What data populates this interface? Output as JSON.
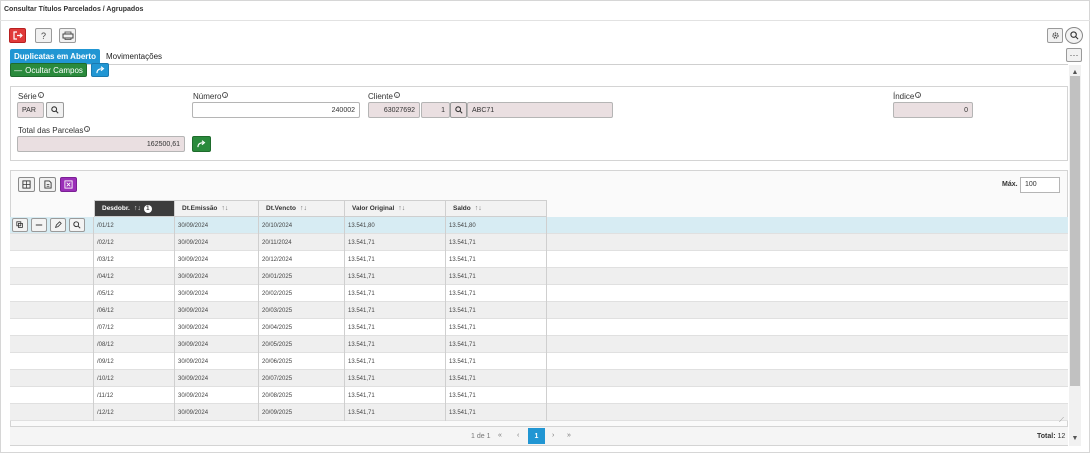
{
  "window": {
    "title": "Consultar Títulos Parcelados / Agrupados"
  },
  "toolbar": {
    "exit_icon": "exit-icon",
    "help_label": "?",
    "help_icon": "question-icon",
    "print_icon": "printer-icon",
    "settings_icon": "gear-icon",
    "search_icon": "search-icon",
    "more_label": "···"
  },
  "tabs": [
    {
      "label": "Duplicatas em Aberto",
      "active": true
    },
    {
      "label": "Movimentações",
      "active": false
    }
  ],
  "actions": {
    "hide_fields_label": "Ocultar Campos",
    "share_icon": "share-icon"
  },
  "form": {
    "serie": {
      "label": "Série",
      "value": "PAR"
    },
    "numero": {
      "label": "Número",
      "value": "240002"
    },
    "cliente": {
      "label": "Cliente",
      "code": "63027692",
      "seq": "1",
      "name": "ABC71"
    },
    "indice": {
      "label": "Índice",
      "value": "0"
    },
    "total_parcelas": {
      "label": "Total das Parcelas",
      "value": "162500,61"
    }
  },
  "grid": {
    "max_label": "Máx.",
    "max_value": "100",
    "columns": [
      {
        "label": "Desdobr.",
        "sort_icon": "sort-asc-icon",
        "badge": "1"
      },
      {
        "label": "Dt.Emissão",
        "sort_icon": "sort-icon"
      },
      {
        "label": "Dt.Vencto",
        "sort_icon": "sort-icon"
      },
      {
        "label": "Valor Original",
        "sort_icon": "sort-icon"
      },
      {
        "label": "Saldo",
        "sort_icon": "sort-icon"
      }
    ],
    "rows": [
      [
        "/01/12",
        "30/09/2024",
        "20/10/2024",
        "13.541,80",
        "13.541,80"
      ],
      [
        "/02/12",
        "30/09/2024",
        "20/11/2024",
        "13.541,71",
        "13.541,71"
      ],
      [
        "/03/12",
        "30/09/2024",
        "20/12/2024",
        "13.541,71",
        "13.541,71"
      ],
      [
        "/04/12",
        "30/09/2024",
        "20/01/2025",
        "13.541,71",
        "13.541,71"
      ],
      [
        "/05/12",
        "30/09/2024",
        "20/02/2025",
        "13.541,71",
        "13.541,71"
      ],
      [
        "/06/12",
        "30/09/2024",
        "20/03/2025",
        "13.541,71",
        "13.541,71"
      ],
      [
        "/07/12",
        "30/09/2024",
        "20/04/2025",
        "13.541,71",
        "13.541,71"
      ],
      [
        "/08/12",
        "30/09/2024",
        "20/05/2025",
        "13.541,71",
        "13.541,71"
      ],
      [
        "/09/12",
        "30/09/2024",
        "20/06/2025",
        "13.541,71",
        "13.541,71"
      ],
      [
        "/10/12",
        "30/09/2024",
        "20/07/2025",
        "13.541,71",
        "13.541,71"
      ],
      [
        "/11/12",
        "30/09/2024",
        "20/08/2025",
        "13.541,71",
        "13.541,71"
      ],
      [
        "/12/12",
        "30/09/2024",
        "20/09/2025",
        "13.541,71",
        "13.541,71"
      ]
    ]
  },
  "pager": {
    "info": "1 de 1",
    "first": "«",
    "prev": "‹",
    "current": "1",
    "next": "›",
    "last": "»",
    "total_label": "Total:",
    "total_value": "12"
  },
  "colors": {
    "primary": "#2196d3",
    "success": "#2a8a3c",
    "danger": "#e03a3a",
    "accent": "#9b2fb8",
    "selected_row": "#d7ecf3"
  }
}
